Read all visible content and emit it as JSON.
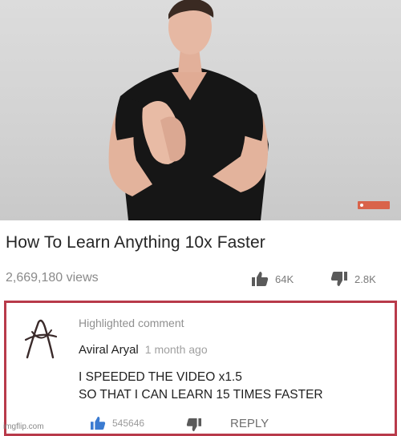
{
  "video": {
    "title": "How To Learn Anything 10x Faster",
    "views": "2,669,180 views",
    "likes": "64K",
    "dislikes": "2.8K",
    "watermark_icon": "channel-logo-icon"
  },
  "comment": {
    "label": "Highlighted comment",
    "author": "Aviral Aryal",
    "time": "1 month ago",
    "lines": [
      "I SPEEDED THE VIDEO x1.5",
      "SO THAT I CAN LEARN 15 TIMES FASTER"
    ],
    "likes": "545646",
    "reply": "REPLY",
    "border_color": "#b83a4a"
  },
  "footer": {
    "watermark": "imgflip.com"
  },
  "colors": {
    "like_icon": "#3b7bd1",
    "icon_dark": "#5a5a5a"
  }
}
